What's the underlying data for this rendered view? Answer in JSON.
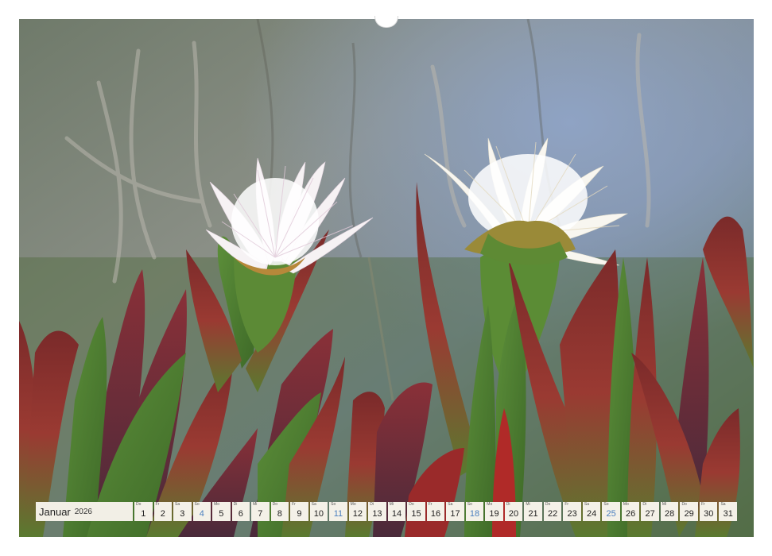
{
  "calendar": {
    "month": "Januar",
    "year": "2026",
    "highlight_color": "#4a7fbf",
    "days": [
      {
        "wd": "Do",
        "num": "1"
      },
      {
        "wd": "Fr",
        "num": "2"
      },
      {
        "wd": "Sa",
        "num": "3"
      },
      {
        "wd": "So",
        "num": "4",
        "hl": true
      },
      {
        "wd": "Mo",
        "num": "5"
      },
      {
        "wd": "Di",
        "num": "6"
      },
      {
        "wd": "Mi",
        "num": "7"
      },
      {
        "wd": "Do",
        "num": "8"
      },
      {
        "wd": "Fr",
        "num": "9"
      },
      {
        "wd": "Sa",
        "num": "10"
      },
      {
        "wd": "So",
        "num": "11",
        "hl": true
      },
      {
        "wd": "Mo",
        "num": "12"
      },
      {
        "wd": "Di",
        "num": "13"
      },
      {
        "wd": "Mi",
        "num": "14"
      },
      {
        "wd": "Do",
        "num": "15"
      },
      {
        "wd": "Fr",
        "num": "16"
      },
      {
        "wd": "Sa",
        "num": "17"
      },
      {
        "wd": "So",
        "num": "18",
        "hl": true
      },
      {
        "wd": "Mo",
        "num": "19"
      },
      {
        "wd": "Di",
        "num": "20"
      },
      {
        "wd": "Mi",
        "num": "21"
      },
      {
        "wd": "Do",
        "num": "22"
      },
      {
        "wd": "Fr",
        "num": "23"
      },
      {
        "wd": "Sa",
        "num": "24"
      },
      {
        "wd": "So",
        "num": "25",
        "hl": true
      },
      {
        "wd": "Mo",
        "num": "26"
      },
      {
        "wd": "Di",
        "num": "27"
      },
      {
        "wd": "Mi",
        "num": "28"
      },
      {
        "wd": "Do",
        "num": "29"
      },
      {
        "wd": "Fr",
        "num": "30"
      },
      {
        "wd": "Sa",
        "num": "31"
      }
    ]
  }
}
